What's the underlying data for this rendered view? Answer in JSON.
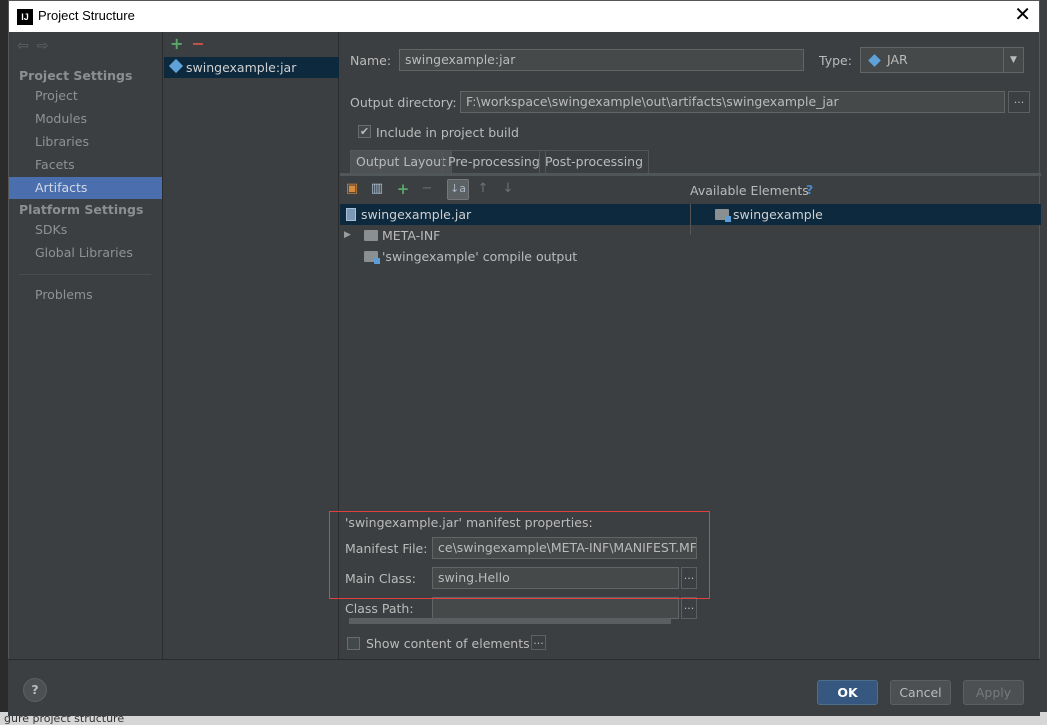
{
  "window": {
    "title": "Project Structure",
    "app_icon": "IJ"
  },
  "nav": {
    "back_icon": "arrow-left-icon",
    "forward_icon": "arrow-right-icon"
  },
  "sidebar": {
    "project_settings_header": "Project Settings",
    "project_items": [
      {
        "label": "Project"
      },
      {
        "label": "Modules"
      },
      {
        "label": "Libraries"
      },
      {
        "label": "Facets"
      },
      {
        "label": "Artifacts",
        "selected": true
      }
    ],
    "platform_settings_header": "Platform Settings",
    "platform_items": [
      {
        "label": "SDKs"
      },
      {
        "label": "Global Libraries"
      }
    ],
    "problems_label": "Problems"
  },
  "artifacts": {
    "add_symbol": "+",
    "remove_symbol": "−",
    "items": [
      {
        "label": "swingexample:jar"
      }
    ]
  },
  "form": {
    "name_label": "Name:",
    "name_value": "swingexample:jar",
    "type_label": "Type:",
    "type_value": "JAR",
    "type_arrow": "▼",
    "output_dir_label": "Output directory:",
    "output_dir_value": "F:\\workspace\\swingexample\\out\\artifacts\\swingexample_jar",
    "browse_label": "...",
    "include_in_build_label": "Include in project build",
    "include_in_build_checked": true,
    "check_mark": "✔"
  },
  "tabs": [
    {
      "label": "Output Layout",
      "active": true
    },
    {
      "label": "Pre-processing"
    },
    {
      "label": "Post-processing"
    }
  ],
  "layout": {
    "available_elements_label": "Available Elements",
    "help_symbol": "?",
    "sort_symbol": "↓a",
    "tree": [
      {
        "label": "swingexample.jar",
        "icon": "jar-icon",
        "selected": true
      },
      {
        "label": "META-INF",
        "icon": "folder-icon",
        "expand": "▶"
      },
      {
        "label": "'swingexample' compile output",
        "icon": "module-folder-icon"
      }
    ],
    "available_items": [
      {
        "label": "swingexample",
        "icon": "module-folder-icon"
      }
    ]
  },
  "manifest": {
    "title": "'swingexample.jar' manifest properties:",
    "file_label": "Manifest File:",
    "file_value": "ce\\swingexample\\META-INF\\MANIFEST.MF",
    "main_class_label": "Main Class:",
    "main_class_value": "swing.Hello",
    "class_path_label": "Class Path:",
    "class_path_value": "",
    "browse_label": "..."
  },
  "show_content": {
    "label": "Show content of elements",
    "checked": false,
    "browse_label": "..."
  },
  "buttons": {
    "help": "?",
    "ok": "OK",
    "cancel": "Cancel",
    "apply": "Apply"
  },
  "behind": {
    "status_text": "gure project structure"
  },
  "colors": {
    "selection": "#4b6eaf",
    "tree_selection": "#0d293e",
    "primary_button": "#365880",
    "annotation_box": "#e0413f"
  }
}
